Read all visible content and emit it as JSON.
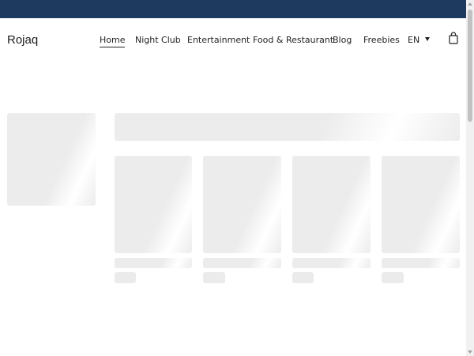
{
  "header": {
    "logo": "Rojaq",
    "nav": {
      "home": "Home",
      "night_club": "Night Club",
      "entertainment": "Entertainment",
      "food_restaurant": "Food & Restaurant",
      "blog": "Blog",
      "freebies": "Freebies"
    },
    "language": "EN"
  },
  "icons": {
    "cart": "shopping-bag-icon",
    "language_dropdown": "caret-down-icon"
  },
  "colors": {
    "topbar": "#1e3a5f",
    "skeleton": "#ececec"
  }
}
